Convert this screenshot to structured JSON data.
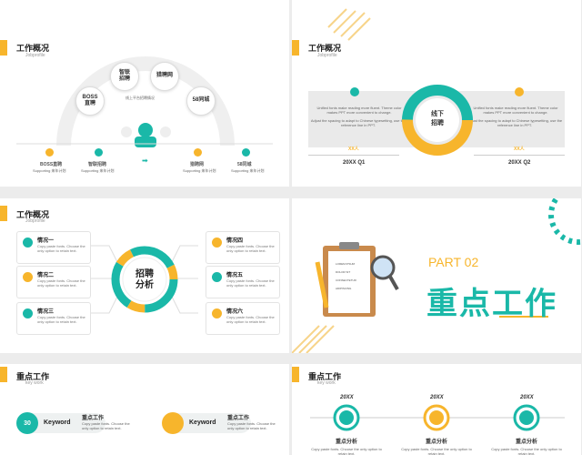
{
  "slide1": {
    "title": "工作概况",
    "subtitle": "Jobprofile",
    "center_caption": "线上平台招聘情况",
    "bubbles": [
      "BOSS\n直聘",
      "智联\n招聘",
      "猎聘网",
      "58同城"
    ],
    "row_labels": [
      "BOSS直聘",
      "智联招聘",
      "猎聘网",
      "58同城"
    ],
    "row_desc": "Supporting 来年计划"
  },
  "slide2": {
    "title": "工作概况",
    "subtitle": "Jobprofile",
    "center": "线下\n招聘",
    "left_text1": "Unified fonts make reading more fluent. Theme color makes PPT more convenient to change.",
    "left_text2": "Adjust the spacing to adapt to Chinese typesetting, use the reference line in PPT.",
    "right_text1": "Unified fonts make reading more fluent. Theme color makes PPT more convenient to change.",
    "right_text2": "Adjust the spacing to adapt to Chinese typesetting, use the reference line in PPT.",
    "left_count": "XX人",
    "right_count": "XX人",
    "left_period": "20XX Q1",
    "right_period": "20XX Q2"
  },
  "slide3": {
    "title": "工作概况",
    "subtitle": "Jobprofile",
    "center": "招聘\n分析",
    "cards": [
      {
        "title": "情况一",
        "desc": "Copy paste fonts. Choose the only option to retain text."
      },
      {
        "title": "情况二",
        "desc": "Copy paste fonts. Choose the only option to retain text."
      },
      {
        "title": "情况三",
        "desc": "Copy paste fonts. Choose the only option to retain text."
      },
      {
        "title": "情况四",
        "desc": "Copy paste fonts. Choose the only option to retain text."
      },
      {
        "title": "情况五",
        "desc": "Copy paste fonts. Choose the only option to retain text."
      },
      {
        "title": "情况六",
        "desc": "Copy paste fonts. Choose the only option to retain text."
      }
    ]
  },
  "slide4": {
    "part": "PART 02",
    "headline": "重点工作",
    "list": [
      "LOREM IPSUM",
      "DOLOR SIT",
      "CONSECTETUR",
      "ADIPISCING"
    ]
  },
  "slide5": {
    "title": "重点工作",
    "subtitle": "key work",
    "keyword": "Keyword",
    "items": [
      {
        "num": "30",
        "title": "重点工作",
        "desc": "Copy paste fonts. Choose the only option to retain text."
      },
      {
        "title": "重点工作",
        "desc": "Copy paste fonts. Choose the only option to retain text."
      }
    ]
  },
  "slide6": {
    "title": "重点工作",
    "subtitle": "key work",
    "years": [
      "20XX",
      "20XX",
      "20XX"
    ],
    "labels": [
      "重点分析",
      "重点分析",
      "重点分析"
    ],
    "desc": "Copy paste fonts. Choose the only option to retain text."
  },
  "colors": {
    "teal": "#1ab8a8",
    "yellow": "#f7b52c"
  }
}
